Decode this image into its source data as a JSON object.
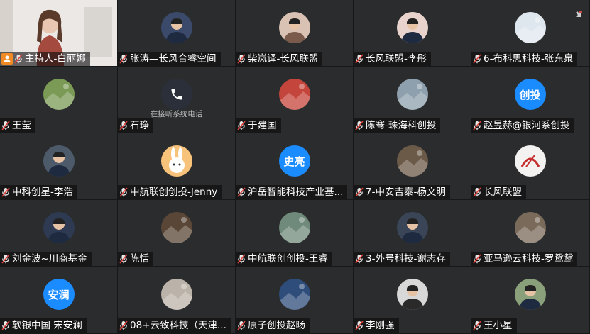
{
  "participants": [
    {
      "name": "主持人-白丽娜",
      "role": "host",
      "video": true
    },
    {
      "name": "张涛—长风合睿空间",
      "avatar": "photo-man-suit"
    },
    {
      "name": "柴岚译-长风联盟",
      "avatar": "photo-woman"
    },
    {
      "name": "长风联盟-李彤",
      "avatar": "photo-cartoon"
    },
    {
      "name": "6-布科思科技-张东泉",
      "avatar": "photo-robots"
    },
    {
      "name": "王莹",
      "avatar": "photo-tree"
    },
    {
      "name": "石琤",
      "avatar": "phone-icon",
      "status": "在接听系统电话"
    },
    {
      "name": "于建国",
      "avatar": "photo-red"
    },
    {
      "name": "陈骞-珠海科创投",
      "avatar": "photo-landscape"
    },
    {
      "name": "赵昱赫@银河系创投",
      "avatar_text": "创投"
    },
    {
      "name": "中科创星-李浩",
      "avatar": "photo-man-glasses"
    },
    {
      "name": "中航联创创投-Jenny",
      "avatar": "photo-rabbit"
    },
    {
      "name": "沪岳智能科技产业基...",
      "avatar_text": "史亮"
    },
    {
      "name": "7-中安吉泰-杨文明",
      "avatar": "photo-room"
    },
    {
      "name": "长风联盟",
      "avatar": "logo-changfeng"
    },
    {
      "name": "刘金波~川商基金",
      "avatar": "photo-man-suit2"
    },
    {
      "name": "陈恬",
      "avatar": "photo-food"
    },
    {
      "name": "中航联创创投-王睿",
      "avatar": "photo-waterfall"
    },
    {
      "name": "3-外号科技-谢志存",
      "avatar": "photo-man-suit3"
    },
    {
      "name": "亚马逊云科技-罗鸳鸳",
      "avatar": "photo-people"
    },
    {
      "name": "软银中国 宋安澜",
      "avatar_text": "安澜"
    },
    {
      "name": "08+云致科技（天津...",
      "avatar": "photo-gray"
    },
    {
      "name": "原子创投赵旸",
      "avatar": "photo-stadium"
    },
    {
      "name": "李刚强",
      "avatar": "photo-man-glasses2"
    },
    {
      "name": "王小星",
      "avatar": "photo-man-outdoor"
    }
  ],
  "colors": {
    "host_badge": "#f08a24",
    "text_avatar": "#1a8cff",
    "tile": "#2b2c2e"
  }
}
